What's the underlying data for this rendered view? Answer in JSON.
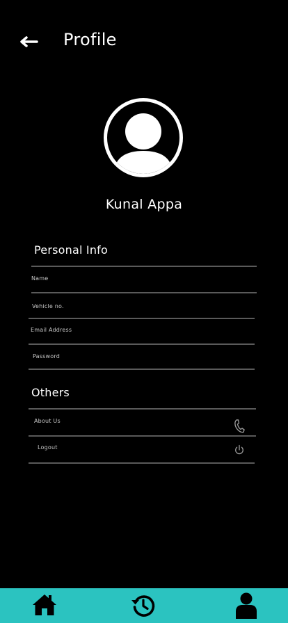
{
  "header": {
    "title": "Profile",
    "back_icon": "arrow-left-icon"
  },
  "profile": {
    "avatar_icon": "user-avatar-icon",
    "name": "Kunal Appa"
  },
  "personal_info": {
    "title": "Personal Info",
    "fields": [
      {
        "label": "Name",
        "value": ""
      },
      {
        "label": "Vehicle no.",
        "value": ""
      },
      {
        "label": "Email Address",
        "value": ""
      },
      {
        "label": "Password",
        "value": ""
      }
    ]
  },
  "others": {
    "title": "Others",
    "items": [
      {
        "label": "About Us",
        "icon": "phone-icon"
      },
      {
        "label": "Logout",
        "icon": "power-icon"
      }
    ]
  },
  "bottom_nav": {
    "items": [
      {
        "icon": "home-icon"
      },
      {
        "icon": "history-icon"
      },
      {
        "icon": "profile-icon"
      }
    ]
  },
  "colors": {
    "background": "#000000",
    "accent": "#2bc3c0",
    "text": "#ffffff",
    "divider": "#5a5a5a"
  }
}
